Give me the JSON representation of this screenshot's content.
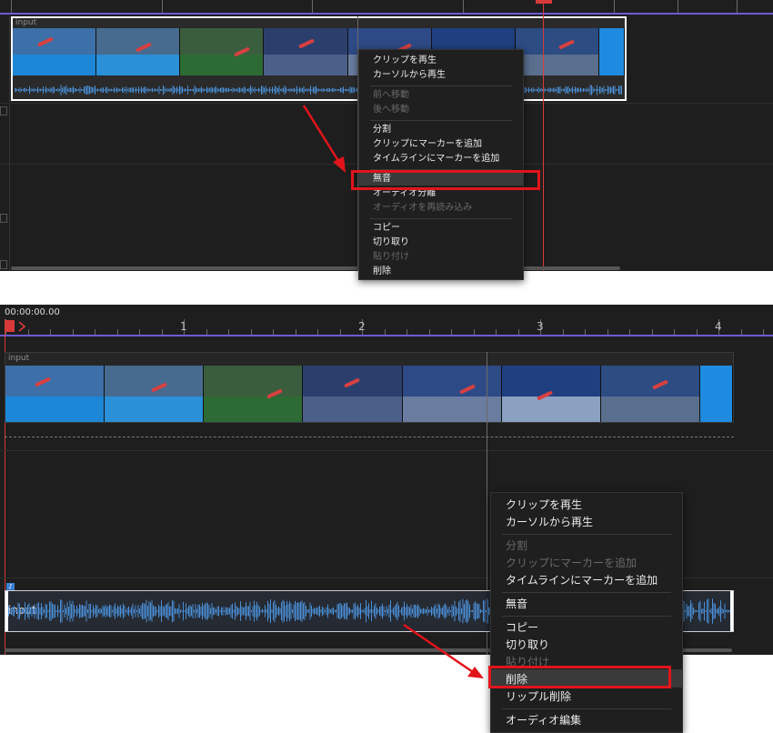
{
  "top_panel": {
    "clip_label": "input",
    "menu": {
      "items": [
        {
          "label": "クリップを再生",
          "enabled": true
        },
        {
          "label": "カーソルから再生",
          "enabled": true
        },
        {
          "label": "前へ移動",
          "enabled": false
        },
        {
          "label": "後へ移動",
          "enabled": false
        },
        {
          "label": "分割",
          "enabled": true
        },
        {
          "label": "クリップにマーカーを追加",
          "enabled": true
        },
        {
          "label": "タイムラインにマーカーを追加",
          "enabled": true
        },
        {
          "label": "無音",
          "enabled": true,
          "highlighted": true
        },
        {
          "label": "オーディオ分離",
          "enabled": true
        },
        {
          "label": "オーディオを再読み込み",
          "enabled": false
        },
        {
          "label": "コピー",
          "enabled": true
        },
        {
          "label": "切り取り",
          "enabled": true
        },
        {
          "label": "貼り付け",
          "enabled": false
        },
        {
          "label": "削除",
          "enabled": true
        }
      ]
    }
  },
  "bottom_panel": {
    "timecode": "00:00:00.00",
    "ruler_labels": [
      "1",
      "2",
      "3",
      "4"
    ],
    "video_clip_label": "input",
    "audio_clip_label": "input",
    "audio_track_badge": "♪",
    "menu": {
      "items": [
        {
          "label": "クリップを再生",
          "enabled": true
        },
        {
          "label": "カーソルから再生",
          "enabled": true
        },
        {
          "label": "分割",
          "enabled": false
        },
        {
          "label": "クリップにマーカーを追加",
          "enabled": false
        },
        {
          "label": "タイムラインにマーカーを追加",
          "enabled": true
        },
        {
          "label": "無音",
          "enabled": true
        },
        {
          "label": "コピー",
          "enabled": true
        },
        {
          "label": "切り取り",
          "enabled": true
        },
        {
          "label": "貼り付け",
          "enabled": false
        },
        {
          "label": "削除",
          "enabled": true,
          "highlighted": true
        },
        {
          "label": "リップル削除",
          "enabled": true
        },
        {
          "label": "オーディオ編集",
          "enabled": true
        }
      ]
    }
  },
  "colors": {
    "panel_bg": "#1e1e1e",
    "ruler_accent": "#6f5bd4",
    "playhead": "#d83a3a",
    "highlight_box": "#e2141b",
    "waveform": "#4a8fd6"
  }
}
